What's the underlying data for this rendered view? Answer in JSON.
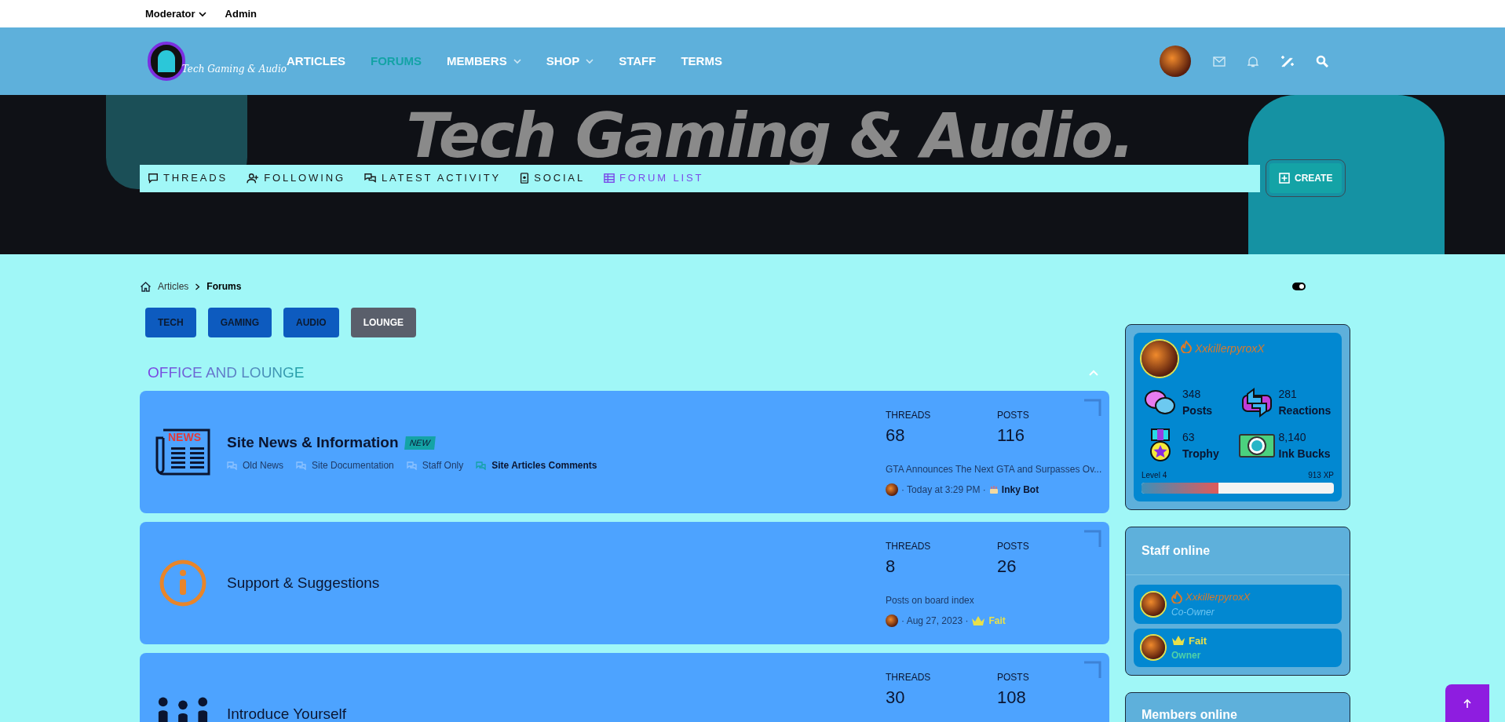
{
  "top_bar": {
    "items": [
      {
        "label": "Moderator",
        "dropdown": true
      },
      {
        "label": "Admin",
        "dropdown": false
      }
    ]
  },
  "header": {
    "logo_text": "Tech Gaming & Audio",
    "nav": [
      {
        "label": "ARTICLES",
        "selected": false,
        "dropdown": false
      },
      {
        "label": "FORUMS",
        "selected": true,
        "dropdown": false
      },
      {
        "label": "MEMBERS",
        "selected": false,
        "dropdown": true
      },
      {
        "label": "SHOP",
        "selected": false,
        "dropdown": true
      },
      {
        "label": "STAFF",
        "selected": false,
        "dropdown": false
      },
      {
        "label": "TERMS",
        "selected": false,
        "dropdown": false
      }
    ]
  },
  "banner": {
    "title": "Tech Gaming & Audio.",
    "subnav": [
      {
        "label": "THREADS",
        "kind": "comment",
        "selected": false
      },
      {
        "label": "FOLLOWING",
        "kind": "user-plus",
        "selected": false
      },
      {
        "label": "LATEST ACTIVITY",
        "kind": "comments",
        "selected": false
      },
      {
        "label": "SOCIAL",
        "kind": "badge",
        "selected": false
      },
      {
        "label": "FORUM LIST",
        "kind": "table",
        "selected": true
      }
    ],
    "create_button": "CREATE"
  },
  "theme_toggle": {
    "on": true
  },
  "breadcrumb": [
    {
      "label": "Articles",
      "current": false
    },
    {
      "label": "Forums",
      "current": true
    }
  ],
  "categories": [
    {
      "label": "TECH",
      "selected": false
    },
    {
      "label": "GAMING",
      "selected": false
    },
    {
      "label": "AUDIO",
      "selected": false
    },
    {
      "label": "LOUNGE",
      "selected": true
    }
  ],
  "section": {
    "title": "OFFICE AND LOUNGE",
    "expanded": true
  },
  "forums": [
    {
      "kind": "news",
      "icon_text": "NEWS",
      "title": "Site News & Information",
      "badge": "NEW",
      "subforums": [
        {
          "label": "Old News",
          "unread": false
        },
        {
          "label": "Site Documentation",
          "unread": false
        },
        {
          "label": "Staff Only",
          "unread": false
        },
        {
          "label": "Site Articles Comments",
          "unread": true
        }
      ],
      "threads_label": "THREADS",
      "threads": "68",
      "posts_label": "POSTS",
      "posts": "116",
      "last_title": "GTA Announces The Next GTA and Surpasses Ov...",
      "last_date": "· Today at 3:29 PM ·",
      "last_user": {
        "name": "Inky Bot",
        "kind": "bot"
      }
    },
    {
      "kind": "info",
      "title": "Support & Suggestions",
      "threads_label": "THREADS",
      "threads": "8",
      "posts_label": "POSTS",
      "posts": "26",
      "last_title": "Posts on board index",
      "last_date": "· Aug 27, 2023 ·",
      "last_user": {
        "name": "Fait",
        "kind": "owner"
      }
    },
    {
      "kind": "people",
      "title": "Introduce Yourself",
      "threads_label": "THREADS",
      "threads": "30",
      "posts_label": "POSTS",
      "posts": "108"
    }
  ],
  "profile": {
    "name": "XxkillerpyroxX",
    "stats": [
      {
        "kind": "posts",
        "value": "348",
        "label": "Posts"
      },
      {
        "kind": "reactions",
        "value": "281",
        "label": "Reactions"
      },
      {
        "kind": "trophy",
        "value": "63",
        "label": "Trophy"
      },
      {
        "kind": "bucks",
        "value": "8,140",
        "label": "Ink Bucks"
      }
    ],
    "level_label": "Level 4",
    "xp": "913 XP",
    "level": 0.4
  },
  "staff_online": {
    "title": "Staff online",
    "members": [
      {
        "name": "XxkillerpyroxX",
        "role": "Co-Owner",
        "kind": "flame",
        "color": "#d97a2b"
      },
      {
        "name": "Fait",
        "role": "Owner",
        "kind": "crown",
        "color": "#e8e04a"
      }
    ]
  },
  "members_online": {
    "title": "Members online"
  }
}
